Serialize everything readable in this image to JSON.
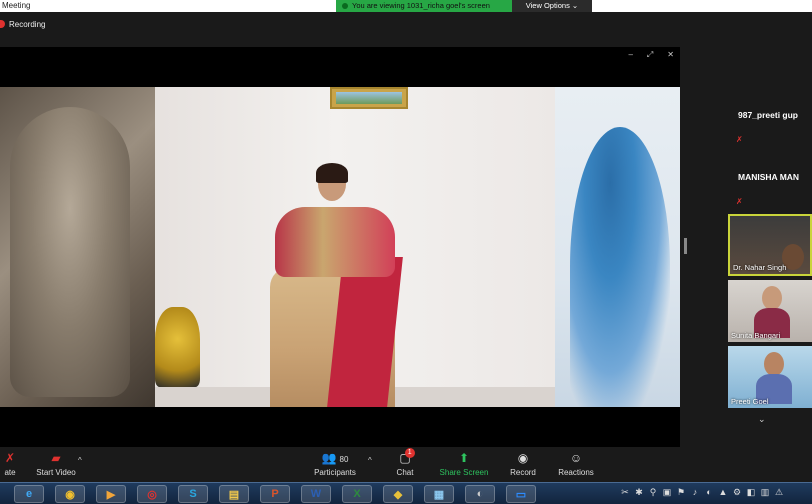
{
  "window": {
    "title": "Meeting",
    "share_banner": "You are viewing 1031_richa goel's screen",
    "view_options": "View Options",
    "view_options_caret": "⌄"
  },
  "recording": {
    "label": "Recording"
  },
  "shared_window": {
    "controls": [
      "–",
      "⤢",
      "✕"
    ]
  },
  "participants": [
    {
      "name": "987_preeti gup",
      "video": false,
      "muted": true
    },
    {
      "name": "MANISHA MAN",
      "video": false,
      "muted": true
    },
    {
      "name": "Dr. Nahar Singh",
      "video": true,
      "muted": false,
      "active_speaker": true
    },
    {
      "name": "Sunita Bangari",
      "video": true,
      "muted": true
    },
    {
      "name": "Preeti Goel",
      "video": true,
      "muted": true
    }
  ],
  "gallery": {
    "scroll_icon": "⌄"
  },
  "toolbar": {
    "audio_label": "ate",
    "start_video": "Start Video",
    "participants_label": "Participants",
    "participants_count": "80",
    "chat": "Chat",
    "chat_badge": "1",
    "share_screen": "Share Screen",
    "record": "Record",
    "reactions": "Reactions",
    "caret": "^"
  },
  "taskbar": {
    "apps": [
      {
        "name": "internet-explorer",
        "glyph": "e",
        "color": "#3fa9f5"
      },
      {
        "name": "chrome",
        "glyph": "◉",
        "color": "#f2c12e"
      },
      {
        "name": "media-player",
        "glyph": "▶",
        "color": "#f2a53a"
      },
      {
        "name": "opera",
        "glyph": "◎",
        "color": "#e0322f"
      },
      {
        "name": "skype",
        "glyph": "S",
        "color": "#29a8e0"
      },
      {
        "name": "file-explorer",
        "glyph": "▤",
        "color": "#f2c94c"
      },
      {
        "name": "powerpoint",
        "glyph": "P",
        "color": "#d9542b"
      },
      {
        "name": "word",
        "glyph": "W",
        "color": "#2b5fb4"
      },
      {
        "name": "excel",
        "glyph": "X",
        "color": "#2e8b3e"
      },
      {
        "name": "tool",
        "glyph": "◆",
        "color": "#e8c13a"
      },
      {
        "name": "photos",
        "glyph": "▦",
        "color": "#8cc8f0"
      },
      {
        "name": "media",
        "glyph": "◐",
        "color": "#cccccc"
      },
      {
        "name": "zoom",
        "glyph": "▭",
        "color": "#2d8cff"
      }
    ],
    "tray": [
      "✂",
      "✱",
      "⚲",
      "▣",
      "⚑",
      "♪",
      "◐",
      "▲",
      "⚙",
      "◧",
      "▥",
      "⚠"
    ]
  }
}
